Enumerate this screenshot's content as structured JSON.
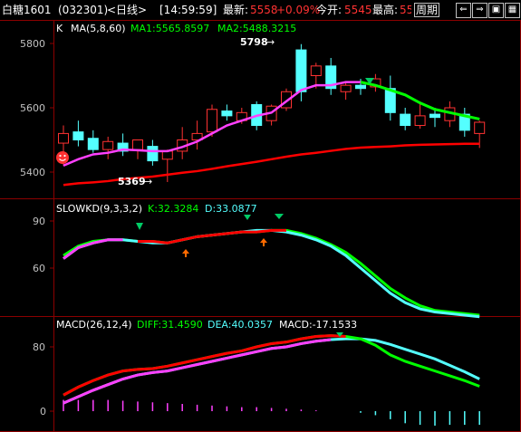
{
  "topbar": {
    "symbol": "白糖1601",
    "code": "(032301)",
    "period_tag": "<日线>",
    "time": "[14:59:59]",
    "last_label": "最新:",
    "last_value": "5558",
    "change_pct": "+0.09%",
    "open_label": "今开:",
    "open_value": "5545",
    "high_label": "最高:",
    "high_value": "55\u0010",
    "period_button": "周期"
  },
  "colors": {
    "up": "#ff3232",
    "down": "#54ffff",
    "ma1": "#ff40ff",
    "ma2": "#ff0000",
    "green": "#00ff00",
    "grid": "#8b0000",
    "axis": "#c0c0c0"
  },
  "kline": {
    "header_k": "K",
    "header_ma": "MA(5,8,60)",
    "header_ma1": "MA1:5565.8597",
    "header_ma2": "MA2:5488.3215",
    "y_ticks": [
      "5800",
      "5600",
      "5400"
    ],
    "high_annotation": "5798",
    "low_annotation": "5369"
  },
  "kd": {
    "header_name": "SLOWKD(9,3,3,2)",
    "header_k": "K:32.3284",
    "header_d": "D:33.0877",
    "y_ticks": [
      "90",
      "60"
    ]
  },
  "macd": {
    "header_name": "MACD(26,12,4)",
    "header_diff": "DIFF:31.4590",
    "header_dea": "DEA:40.0357",
    "header_macd": "MACD:-17.1533",
    "y_ticks": [
      "80",
      "0"
    ]
  },
  "chart_data": [
    {
      "type": "candlestick",
      "ylim": [
        5300,
        5850
      ],
      "ticks": [
        5400,
        5600,
        5800
      ],
      "candles": [
        {
          "o": 5490,
          "h": 5545,
          "l": 5420,
          "c": 5520
        },
        {
          "o": 5525,
          "h": 5560,
          "l": 5480,
          "c": 5500
        },
        {
          "o": 5505,
          "h": 5530,
          "l": 5460,
          "c": 5470
        },
        {
          "o": 5470,
          "h": 5510,
          "l": 5440,
          "c": 5495
        },
        {
          "o": 5490,
          "h": 5520,
          "l": 5450,
          "c": 5465
        },
        {
          "o": 5470,
          "h": 5500,
          "l": 5440,
          "c": 5500
        },
        {
          "o": 5480,
          "h": 5500,
          "l": 5420,
          "c": 5435
        },
        {
          "o": 5440,
          "h": 5470,
          "l": 5369,
          "c": 5465
        },
        {
          "o": 5465,
          "h": 5540,
          "l": 5440,
          "c": 5500
        },
        {
          "o": 5500,
          "h": 5560,
          "l": 5470,
          "c": 5520
        },
        {
          "o": 5525,
          "h": 5610,
          "l": 5510,
          "c": 5595
        },
        {
          "o": 5590,
          "h": 5610,
          "l": 5560,
          "c": 5575
        },
        {
          "o": 5560,
          "h": 5600,
          "l": 5550,
          "c": 5585
        },
        {
          "o": 5610,
          "h": 5620,
          "l": 5530,
          "c": 5545
        },
        {
          "o": 5560,
          "h": 5610,
          "l": 5545,
          "c": 5605
        },
        {
          "o": 5600,
          "h": 5660,
          "l": 5590,
          "c": 5650
        },
        {
          "o": 5780,
          "h": 5798,
          "l": 5620,
          "c": 5650
        },
        {
          "o": 5700,
          "h": 5740,
          "l": 5660,
          "c": 5730
        },
        {
          "o": 5730,
          "h": 5755,
          "l": 5640,
          "c": 5660
        },
        {
          "o": 5650,
          "h": 5680,
          "l": 5625,
          "c": 5670
        },
        {
          "o": 5670,
          "h": 5690,
          "l": 5640,
          "c": 5660
        },
        {
          "o": 5665,
          "h": 5705,
          "l": 5650,
          "c": 5690
        },
        {
          "o": 5660,
          "h": 5700,
          "l": 5560,
          "c": 5585
        },
        {
          "o": 5580,
          "h": 5600,
          "l": 5530,
          "c": 5545
        },
        {
          "o": 5545,
          "h": 5620,
          "l": 5535,
          "c": 5575
        },
        {
          "o": 5580,
          "h": 5600,
          "l": 5540,
          "c": 5570
        },
        {
          "o": 5560,
          "h": 5620,
          "l": 5540,
          "c": 5600
        },
        {
          "o": 5580,
          "h": 5600,
          "l": 5510,
          "c": 5530
        },
        {
          "o": 5520,
          "h": 5560,
          "l": 5475,
          "c": 5555
        }
      ],
      "ma1": [
        5420,
        5440,
        5455,
        5460,
        5470,
        5468,
        5465,
        5465,
        5478,
        5495,
        5520,
        5545,
        5560,
        5575,
        5585,
        5620,
        5655,
        5670,
        5670,
        5680,
        5680,
        5670,
        5655,
        5640,
        5615,
        5595,
        5585,
        5575,
        5565
      ],
      "ma2": [
        5360,
        5365,
        5368,
        5372,
        5378,
        5382,
        5386,
        5392,
        5398,
        5403,
        5410,
        5418,
        5425,
        5432,
        5440,
        5448,
        5455,
        5460,
        5466,
        5472,
        5476,
        5478,
        5480,
        5483,
        5485,
        5486,
        5487,
        5488,
        5488
      ]
    },
    {
      "type": "line",
      "ylim": [
        20,
        100
      ],
      "ticks": [
        60,
        90
      ],
      "k": [
        66,
        73,
        76,
        78,
        78,
        77,
        76,
        76,
        78,
        80,
        81,
        82,
        83,
        84,
        84,
        83,
        81,
        78,
        74,
        68,
        60,
        52,
        44,
        38,
        34,
        32,
        31,
        30,
        29
      ],
      "d": [
        68,
        74,
        77,
        78,
        78,
        77,
        77,
        76,
        78,
        80,
        81,
        82,
        83,
        83,
        84,
        84,
        82,
        79,
        75,
        70,
        63,
        55,
        47,
        41,
        36,
        33,
        32,
        31,
        30
      ]
    },
    {
      "type": "line",
      "ylim": [
        -10,
        110
      ],
      "ticks": [
        0,
        80
      ],
      "diff": [
        20,
        30,
        38,
        45,
        50,
        52,
        53,
        56,
        60,
        64,
        68,
        72,
        75,
        80,
        84,
        86,
        90,
        93,
        94,
        93,
        90,
        82,
        70,
        62,
        56,
        50,
        44,
        38,
        31
      ],
      "dea": [
        10,
        18,
        26,
        33,
        40,
        45,
        48,
        50,
        54,
        58,
        62,
        66,
        70,
        74,
        78,
        80,
        84,
        87,
        89,
        90,
        90,
        88,
        83,
        77,
        71,
        65,
        57,
        49,
        40
      ],
      "macd": [
        14,
        14,
        14,
        14,
        13,
        12,
        11,
        10,
        9,
        8,
        7,
        6,
        5,
        5,
        4,
        3,
        2,
        1,
        0,
        0,
        -2,
        -5,
        -10,
        -15,
        -17,
        -18,
        -17,
        -17,
        -17
      ]
    }
  ]
}
